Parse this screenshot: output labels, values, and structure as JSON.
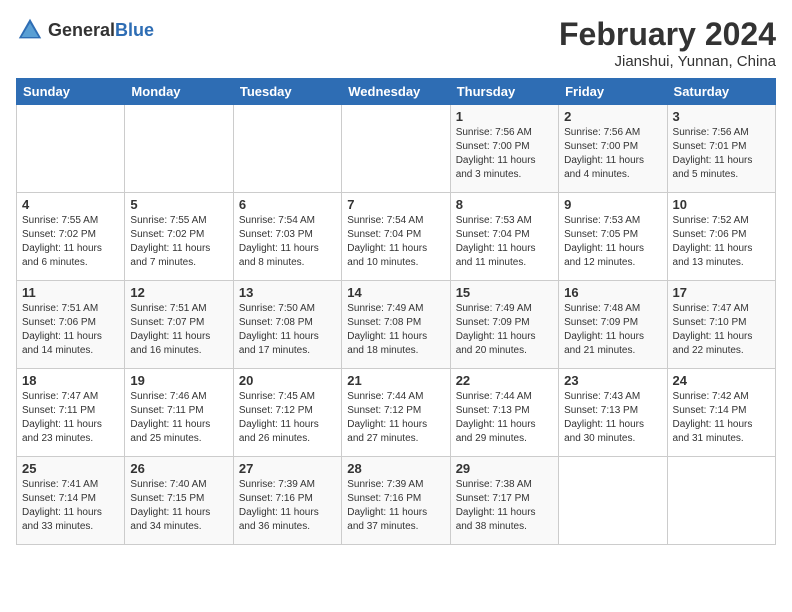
{
  "logo": {
    "general": "General",
    "blue": "Blue"
  },
  "header": {
    "month": "February 2024",
    "location": "Jianshui, Yunnan, China"
  },
  "weekdays": [
    "Sunday",
    "Monday",
    "Tuesday",
    "Wednesday",
    "Thursday",
    "Friday",
    "Saturday"
  ],
  "weeks": [
    [
      {
        "day": "",
        "info": ""
      },
      {
        "day": "",
        "info": ""
      },
      {
        "day": "",
        "info": ""
      },
      {
        "day": "",
        "info": ""
      },
      {
        "day": "1",
        "info": "Sunrise: 7:56 AM\nSunset: 7:00 PM\nDaylight: 11 hours\nand 3 minutes."
      },
      {
        "day": "2",
        "info": "Sunrise: 7:56 AM\nSunset: 7:00 PM\nDaylight: 11 hours\nand 4 minutes."
      },
      {
        "day": "3",
        "info": "Sunrise: 7:56 AM\nSunset: 7:01 PM\nDaylight: 11 hours\nand 5 minutes."
      }
    ],
    [
      {
        "day": "4",
        "info": "Sunrise: 7:55 AM\nSunset: 7:02 PM\nDaylight: 11 hours\nand 6 minutes."
      },
      {
        "day": "5",
        "info": "Sunrise: 7:55 AM\nSunset: 7:02 PM\nDaylight: 11 hours\nand 7 minutes."
      },
      {
        "day": "6",
        "info": "Sunrise: 7:54 AM\nSunset: 7:03 PM\nDaylight: 11 hours\nand 8 minutes."
      },
      {
        "day": "7",
        "info": "Sunrise: 7:54 AM\nSunset: 7:04 PM\nDaylight: 11 hours\nand 10 minutes."
      },
      {
        "day": "8",
        "info": "Sunrise: 7:53 AM\nSunset: 7:04 PM\nDaylight: 11 hours\nand 11 minutes."
      },
      {
        "day": "9",
        "info": "Sunrise: 7:53 AM\nSunset: 7:05 PM\nDaylight: 11 hours\nand 12 minutes."
      },
      {
        "day": "10",
        "info": "Sunrise: 7:52 AM\nSunset: 7:06 PM\nDaylight: 11 hours\nand 13 minutes."
      }
    ],
    [
      {
        "day": "11",
        "info": "Sunrise: 7:51 AM\nSunset: 7:06 PM\nDaylight: 11 hours\nand 14 minutes."
      },
      {
        "day": "12",
        "info": "Sunrise: 7:51 AM\nSunset: 7:07 PM\nDaylight: 11 hours\nand 16 minutes."
      },
      {
        "day": "13",
        "info": "Sunrise: 7:50 AM\nSunset: 7:08 PM\nDaylight: 11 hours\nand 17 minutes."
      },
      {
        "day": "14",
        "info": "Sunrise: 7:49 AM\nSunset: 7:08 PM\nDaylight: 11 hours\nand 18 minutes."
      },
      {
        "day": "15",
        "info": "Sunrise: 7:49 AM\nSunset: 7:09 PM\nDaylight: 11 hours\nand 20 minutes."
      },
      {
        "day": "16",
        "info": "Sunrise: 7:48 AM\nSunset: 7:09 PM\nDaylight: 11 hours\nand 21 minutes."
      },
      {
        "day": "17",
        "info": "Sunrise: 7:47 AM\nSunset: 7:10 PM\nDaylight: 11 hours\nand 22 minutes."
      }
    ],
    [
      {
        "day": "18",
        "info": "Sunrise: 7:47 AM\nSunset: 7:11 PM\nDaylight: 11 hours\nand 23 minutes."
      },
      {
        "day": "19",
        "info": "Sunrise: 7:46 AM\nSunset: 7:11 PM\nDaylight: 11 hours\nand 25 minutes."
      },
      {
        "day": "20",
        "info": "Sunrise: 7:45 AM\nSunset: 7:12 PM\nDaylight: 11 hours\nand 26 minutes."
      },
      {
        "day": "21",
        "info": "Sunrise: 7:44 AM\nSunset: 7:12 PM\nDaylight: 11 hours\nand 27 minutes."
      },
      {
        "day": "22",
        "info": "Sunrise: 7:44 AM\nSunset: 7:13 PM\nDaylight: 11 hours\nand 29 minutes."
      },
      {
        "day": "23",
        "info": "Sunrise: 7:43 AM\nSunset: 7:13 PM\nDaylight: 11 hours\nand 30 minutes."
      },
      {
        "day": "24",
        "info": "Sunrise: 7:42 AM\nSunset: 7:14 PM\nDaylight: 11 hours\nand 31 minutes."
      }
    ],
    [
      {
        "day": "25",
        "info": "Sunrise: 7:41 AM\nSunset: 7:14 PM\nDaylight: 11 hours\nand 33 minutes."
      },
      {
        "day": "26",
        "info": "Sunrise: 7:40 AM\nSunset: 7:15 PM\nDaylight: 11 hours\nand 34 minutes."
      },
      {
        "day": "27",
        "info": "Sunrise: 7:39 AM\nSunset: 7:16 PM\nDaylight: 11 hours\nand 36 minutes."
      },
      {
        "day": "28",
        "info": "Sunrise: 7:39 AM\nSunset: 7:16 PM\nDaylight: 11 hours\nand 37 minutes."
      },
      {
        "day": "29",
        "info": "Sunrise: 7:38 AM\nSunset: 7:17 PM\nDaylight: 11 hours\nand 38 minutes."
      },
      {
        "day": "",
        "info": ""
      },
      {
        "day": "",
        "info": ""
      }
    ]
  ]
}
